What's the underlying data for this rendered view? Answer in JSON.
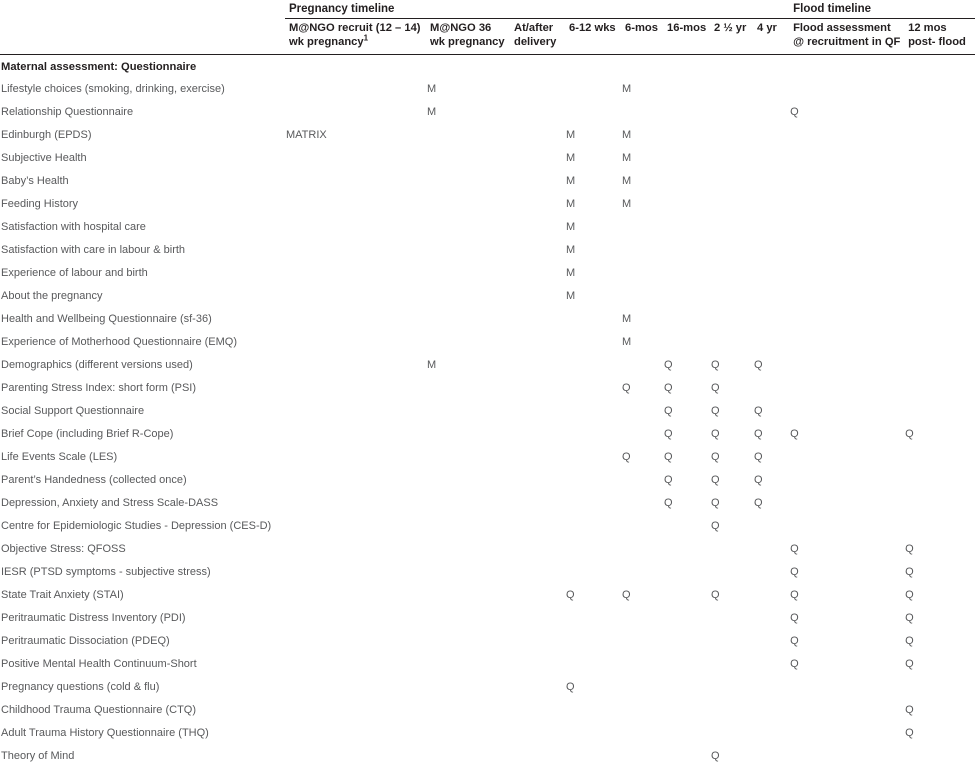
{
  "table": {
    "group_headers": [
      {
        "label": "",
        "span": 1
      },
      {
        "label": "Pregnancy timeline",
        "span": 8
      },
      {
        "label": "Flood timeline",
        "span": 2
      }
    ],
    "group_pregnancy": "Pregnancy timeline",
    "group_flood": "Flood timeline",
    "columns": [
      {
        "key": "label",
        "label": ""
      },
      {
        "key": "recruit",
        "label": "M@NGO recruit (12 – 14) wk pregnancy",
        "footnote": "1"
      },
      {
        "key": "w36",
        "label": "M@NGO 36 wk pregnancy"
      },
      {
        "key": "delivery",
        "label": "At/after delivery"
      },
      {
        "key": "wks612",
        "label": "6-12 wks"
      },
      {
        "key": "mos6",
        "label": "6-mos"
      },
      {
        "key": "mos16",
        "label": "16-mos"
      },
      {
        "key": "yr25",
        "label": "2 ½ yr"
      },
      {
        "key": "yr4",
        "label": "4 yr"
      },
      {
        "key": "floodrec",
        "label": "Flood assessment @ recruitment in QF"
      },
      {
        "key": "post12mos",
        "label": "12 mos post- flood"
      }
    ],
    "section_title": "Maternal assessment: Questionnaire",
    "rows": [
      {
        "label": "Lifestyle choices (smoking, drinking, exercise)",
        "recruit": "",
        "w36": "M",
        "delivery": "",
        "wks612": "",
        "mos6": "M",
        "mos16": "",
        "yr25": "",
        "yr4": "",
        "floodrec": "",
        "post12mos": ""
      },
      {
        "label": "Relationship Questionnaire",
        "recruit": "",
        "w36": "M",
        "delivery": "",
        "wks612": "",
        "mos6": "",
        "mos16": "",
        "yr25": "",
        "yr4": "",
        "floodrec": "Q",
        "post12mos": ""
      },
      {
        "label": "Edinburgh (EPDS)",
        "recruit": "MATRIX",
        "w36": "",
        "delivery": "",
        "wks612": "M",
        "mos6": "M",
        "mos16": "",
        "yr25": "",
        "yr4": "",
        "floodrec": "",
        "post12mos": ""
      },
      {
        "label": "Subjective Health",
        "recruit": "",
        "w36": "",
        "delivery": "",
        "wks612": "M",
        "mos6": "M",
        "mos16": "",
        "yr25": "",
        "yr4": "",
        "floodrec": "",
        "post12mos": ""
      },
      {
        "label": "Baby’s Health",
        "recruit": "",
        "w36": "",
        "delivery": "",
        "wks612": "M",
        "mos6": "M",
        "mos16": "",
        "yr25": "",
        "yr4": "",
        "floodrec": "",
        "post12mos": ""
      },
      {
        "label": "Feeding History",
        "recruit": "",
        "w36": "",
        "delivery": "",
        "wks612": "M",
        "mos6": "M",
        "mos16": "",
        "yr25": "",
        "yr4": "",
        "floodrec": "",
        "post12mos": ""
      },
      {
        "label": "Satisfaction with hospital care",
        "recruit": "",
        "w36": "",
        "delivery": "",
        "wks612": "M",
        "mos6": "",
        "mos16": "",
        "yr25": "",
        "yr4": "",
        "floodrec": "",
        "post12mos": ""
      },
      {
        "label": "Satisfaction with care in labour & birth",
        "recruit": "",
        "w36": "",
        "delivery": "",
        "wks612": "M",
        "mos6": "",
        "mos16": "",
        "yr25": "",
        "yr4": "",
        "floodrec": "",
        "post12mos": ""
      },
      {
        "label": "Experience of labour and birth",
        "recruit": "",
        "w36": "",
        "delivery": "",
        "wks612": "M",
        "mos6": "",
        "mos16": "",
        "yr25": "",
        "yr4": "",
        "floodrec": "",
        "post12mos": ""
      },
      {
        "label": "About the pregnancy",
        "recruit": "",
        "w36": "",
        "delivery": "",
        "wks612": "M",
        "mos6": "",
        "mos16": "",
        "yr25": "",
        "yr4": "",
        "floodrec": "",
        "post12mos": ""
      },
      {
        "label": "Health and Wellbeing Questionnaire (sf-36)",
        "recruit": "",
        "w36": "",
        "delivery": "",
        "wks612": "",
        "mos6": "M",
        "mos16": "",
        "yr25": "",
        "yr4": "",
        "floodrec": "",
        "post12mos": ""
      },
      {
        "label": "Experience of Motherhood Questionnaire (EMQ)",
        "recruit": "",
        "w36": "",
        "delivery": "",
        "wks612": "",
        "mos6": "M",
        "mos16": "",
        "yr25": "",
        "yr4": "",
        "floodrec": "",
        "post12mos": ""
      },
      {
        "label": "Demographics (different versions used)",
        "recruit": "",
        "w36": "M",
        "delivery": "",
        "wks612": "",
        "mos6": "",
        "mos16": "Q",
        "yr25": "Q",
        "yr4": "Q",
        "floodrec": "",
        "post12mos": ""
      },
      {
        "label": "Parenting Stress Index: short form (PSI)",
        "recruit": "",
        "w36": "",
        "delivery": "",
        "wks612": "",
        "mos6": "Q",
        "mos16": "Q",
        "yr25": "Q",
        "yr4": "",
        "floodrec": "",
        "post12mos": ""
      },
      {
        "label": "Social Support Questionnaire",
        "recruit": "",
        "w36": "",
        "delivery": "",
        "wks612": "",
        "mos6": "",
        "mos16": "Q",
        "yr25": "Q",
        "yr4": "Q",
        "floodrec": "",
        "post12mos": ""
      },
      {
        "label": "Brief Cope (including Brief R-Cope)",
        "recruit": "",
        "w36": "",
        "delivery": "",
        "wks612": "",
        "mos6": "",
        "mos16": "Q",
        "yr25": "Q",
        "yr4": "Q",
        "floodrec": "Q",
        "post12mos": "Q"
      },
      {
        "label": "Life Events Scale (LES)",
        "recruit": "",
        "w36": "",
        "delivery": "",
        "wks612": "",
        "mos6": "Q",
        "mos16": "Q",
        "yr25": "Q",
        "yr4": "Q",
        "floodrec": "",
        "post12mos": ""
      },
      {
        "label": "Parent’s Handedness (collected once)",
        "recruit": "",
        "w36": "",
        "delivery": "",
        "wks612": "",
        "mos6": "",
        "mos16": "Q",
        "yr25": "Q",
        "yr4": "Q",
        "floodrec": "",
        "post12mos": ""
      },
      {
        "label": "Depression, Anxiety and Stress Scale-DASS",
        "recruit": "",
        "w36": "",
        "delivery": "",
        "wks612": "",
        "mos6": "",
        "mos16": "Q",
        "yr25": "Q",
        "yr4": "Q",
        "floodrec": "",
        "post12mos": ""
      },
      {
        "label": "Centre for Epidemiologic Studies - Depression (CES-D)",
        "recruit": "",
        "w36": "",
        "delivery": "",
        "wks612": "",
        "mos6": "",
        "mos16": "",
        "yr25": "Q",
        "yr4": "",
        "floodrec": "",
        "post12mos": ""
      },
      {
        "label": "Objective Stress: QFOSS",
        "recruit": "",
        "w36": "",
        "delivery": "",
        "wks612": "",
        "mos6": "",
        "mos16": "",
        "yr25": "",
        "yr4": "",
        "floodrec": "Q",
        "post12mos": "Q"
      },
      {
        "label": "IESR (PTSD symptoms - subjective stress)",
        "recruit": "",
        "w36": "",
        "delivery": "",
        "wks612": "",
        "mos6": "",
        "mos16": "",
        "yr25": "",
        "yr4": "",
        "floodrec": "Q",
        "post12mos": "Q"
      },
      {
        "label": "State Trait Anxiety (STAI)",
        "recruit": "",
        "w36": "",
        "delivery": "",
        "wks612": "Q",
        "mos6": "Q",
        "mos16": "",
        "yr25": "Q",
        "yr4": "",
        "floodrec": "Q",
        "post12mos": "Q"
      },
      {
        "label": "Peritraumatic Distress Inventory (PDI)",
        "recruit": "",
        "w36": "",
        "delivery": "",
        "wks612": "",
        "mos6": "",
        "mos16": "",
        "yr25": "",
        "yr4": "",
        "floodrec": "Q",
        "post12mos": "Q"
      },
      {
        "label": "Peritraumatic Dissociation (PDEQ)",
        "recruit": "",
        "w36": "",
        "delivery": "",
        "wks612": "",
        "mos6": "",
        "mos16": "",
        "yr25": "",
        "yr4": "",
        "floodrec": "Q",
        "post12mos": "Q"
      },
      {
        "label": "Positive Mental Health Continuum-Short",
        "recruit": "",
        "w36": "",
        "delivery": "",
        "wks612": "",
        "mos6": "",
        "mos16": "",
        "yr25": "",
        "yr4": "",
        "floodrec": "Q",
        "post12mos": "Q"
      },
      {
        "label": "Pregnancy questions (cold & flu)",
        "recruit": "",
        "w36": "",
        "delivery": "",
        "wks612": "Q",
        "mos6": "",
        "mos16": "",
        "yr25": "",
        "yr4": "",
        "floodrec": "",
        "post12mos": ""
      },
      {
        "label": "Childhood Trauma Questionnaire (CTQ)",
        "recruit": "",
        "w36": "",
        "delivery": "",
        "wks612": "",
        "mos6": "",
        "mos16": "",
        "yr25": "",
        "yr4": "",
        "floodrec": "",
        "post12mos": "Q"
      },
      {
        "label": "Adult Trauma History Questionnaire (THQ)",
        "recruit": "",
        "w36": "",
        "delivery": "",
        "wks612": "",
        "mos6": "",
        "mos16": "",
        "yr25": "",
        "yr4": "",
        "floodrec": "",
        "post12mos": "Q"
      },
      {
        "label": "Theory of Mind",
        "recruit": "",
        "w36": "",
        "delivery": "",
        "wks612": "",
        "mos6": "",
        "mos16": "",
        "yr25": "Q",
        "yr4": "",
        "floodrec": "",
        "post12mos": ""
      }
    ]
  }
}
